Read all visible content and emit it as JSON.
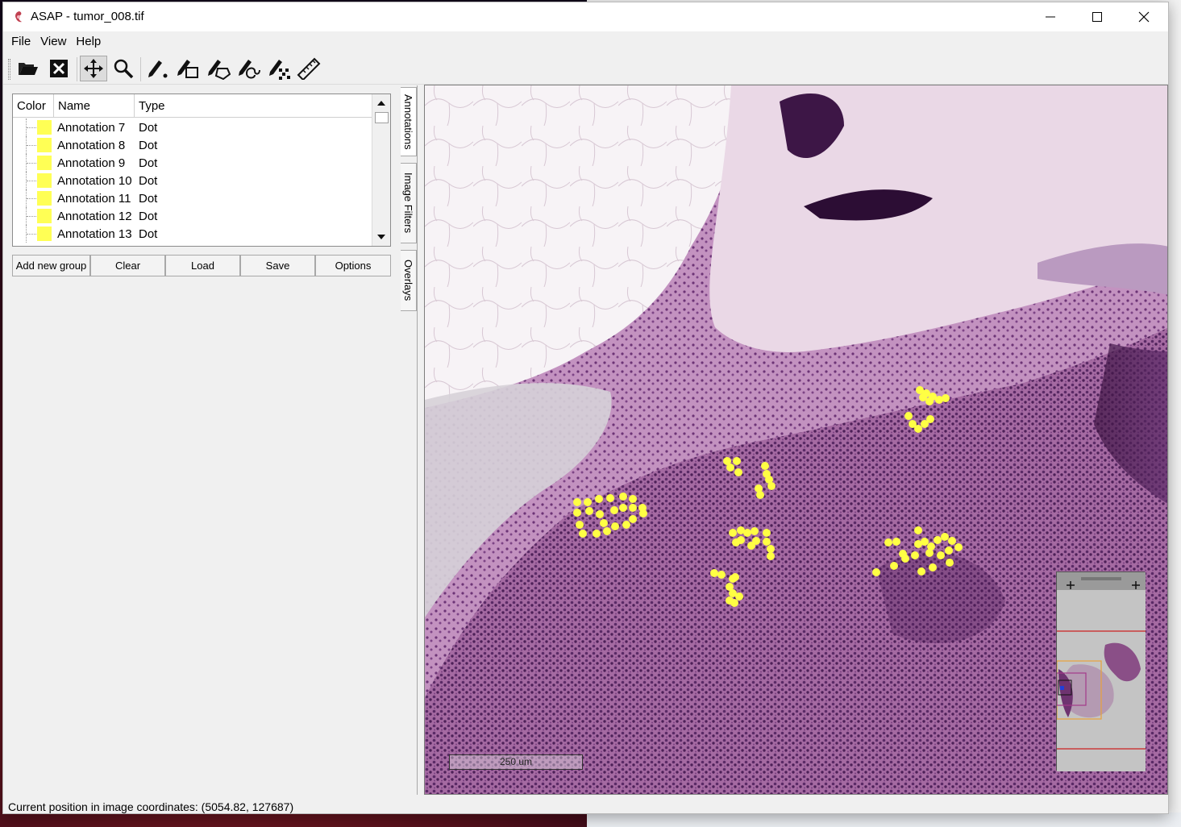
{
  "window": {
    "title": "ASAP - tumor_008.tif",
    "controls": {
      "minimize": "minimize-icon",
      "maximize": "maximize-icon",
      "close": "close-icon"
    }
  },
  "menu": [
    "File",
    "View",
    "Help"
  ],
  "toolbar": {
    "tools": [
      {
        "name": "open-folder-icon"
      },
      {
        "name": "close-file-icon"
      },
      {
        "name": "pan-icon",
        "active": true
      },
      {
        "name": "zoom-icon"
      },
      {
        "name": "dot-annotation-icon"
      },
      {
        "name": "rectangle-annotation-icon"
      },
      {
        "name": "polygon-annotation-icon"
      },
      {
        "name": "spline-annotation-icon"
      },
      {
        "name": "pointset-annotation-icon"
      },
      {
        "name": "measure-ruler-icon"
      }
    ]
  },
  "annotations": {
    "columns": [
      "Color",
      "Name",
      "Type"
    ],
    "rows": [
      {
        "name": "Annotation 7",
        "type": "Dot",
        "color": "#ffff55"
      },
      {
        "name": "Annotation 8",
        "type": "Dot",
        "color": "#ffff55"
      },
      {
        "name": "Annotation 9",
        "type": "Dot",
        "color": "#ffff55"
      },
      {
        "name": "Annotation 10",
        "type": "Dot",
        "color": "#ffff55"
      },
      {
        "name": "Annotation 11",
        "type": "Dot",
        "color": "#ffff55"
      },
      {
        "name": "Annotation 12",
        "type": "Dot",
        "color": "#ffff55"
      },
      {
        "name": "Annotation 13",
        "type": "Dot",
        "color": "#ffff55"
      }
    ],
    "buttons": [
      "Add new group",
      "Clear",
      "Load",
      "Save",
      "Options"
    ]
  },
  "side_tabs": [
    "Annotations",
    "Image Filters",
    "Overlays"
  ],
  "viewer": {
    "scale_bar": "250 um",
    "annotation_color": "#ffff44"
  },
  "status": "Current position in image coordinates: (5054.82, 127687)"
}
